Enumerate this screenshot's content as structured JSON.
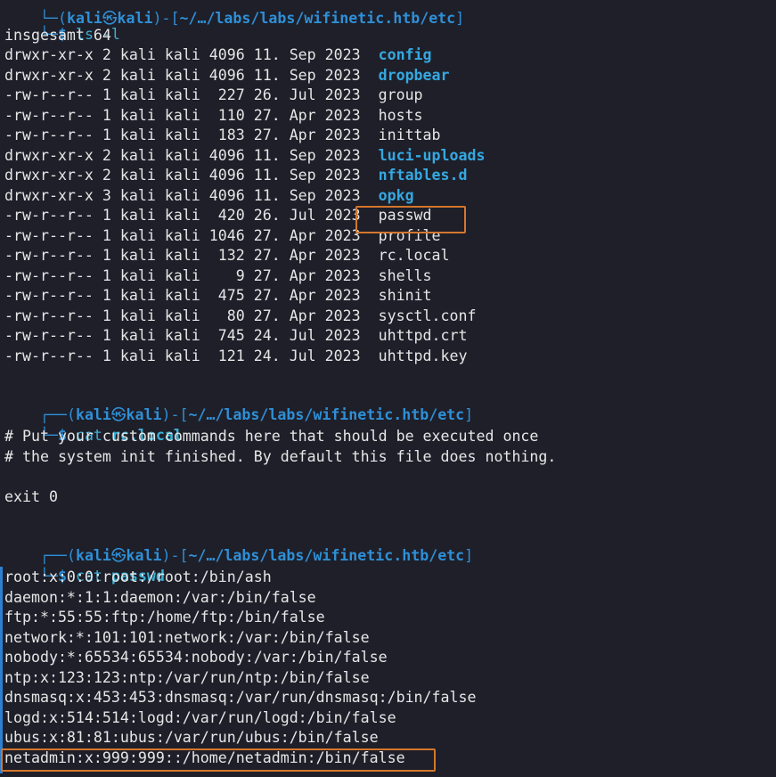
{
  "prompt": {
    "user": "kali",
    "host": "kali",
    "at_symbol": "㉿",
    "path": "~/…/labs/labs/wifinetic.htb/etc",
    "dollar": "$"
  },
  "ls_command": {
    "cmd": "ls",
    "args": "-l"
  },
  "ls_total": "insgesamt 64",
  "ls_entries": [
    {
      "meta": "drwxr-xr-x 2 kali kali 4096 11. Sep 2023  ",
      "name": "config",
      "dir": true
    },
    {
      "meta": "drwxr-xr-x 2 kali kali 4096 11. Sep 2023  ",
      "name": "dropbear",
      "dir": true
    },
    {
      "meta": "-rw-r--r-- 1 kali kali  227 26. Jul 2023  ",
      "name": "group",
      "dir": false
    },
    {
      "meta": "-rw-r--r-- 1 kali kali  110 27. Apr 2023  ",
      "name": "hosts",
      "dir": false
    },
    {
      "meta": "-rw-r--r-- 1 kali kali  183 27. Apr 2023  ",
      "name": "inittab",
      "dir": false
    },
    {
      "meta": "drwxr-xr-x 2 kali kali 4096 11. Sep 2023  ",
      "name": "luci-uploads",
      "dir": true
    },
    {
      "meta": "drwxr-xr-x 2 kali kali 4096 11. Sep 2023  ",
      "name": "nftables.d",
      "dir": true
    },
    {
      "meta": "drwxr-xr-x 3 kali kali 4096 11. Sep 2023  ",
      "name": "opkg",
      "dir": true
    },
    {
      "meta": "-rw-r--r-- 1 kali kali  420 26. Jul 2023  ",
      "name": "passwd",
      "dir": false
    },
    {
      "meta": "-rw-r--r-- 1 kali kali 1046 27. Apr 2023  ",
      "name": "profile",
      "dir": false
    },
    {
      "meta": "-rw-r--r-- 1 kali kali  132 27. Apr 2023  ",
      "name": "rc.local",
      "dir": false
    },
    {
      "meta": "-rw-r--r-- 1 kali kali    9 27. Apr 2023  ",
      "name": "shells",
      "dir": false
    },
    {
      "meta": "-rw-r--r-- 1 kali kali  475 27. Apr 2023  ",
      "name": "shinit",
      "dir": false
    },
    {
      "meta": "-rw-r--r-- 1 kali kali   80 27. Apr 2023  ",
      "name": "sysctl.conf",
      "dir": false
    },
    {
      "meta": "-rw-r--r-- 1 kali kali  745 24. Jul 2023  ",
      "name": "uhttpd.crt",
      "dir": false
    },
    {
      "meta": "-rw-r--r-- 1 kali kali  121 24. Jul 2023  ",
      "name": "uhttpd.key",
      "dir": false
    }
  ],
  "cat1": {
    "cmd": "cat",
    "arg": "rc.local"
  },
  "rc_local_lines": [
    "# Put your custom commands here that should be executed once",
    "# the system init finished. By default this file does nothing.",
    "",
    "exit 0"
  ],
  "cat2": {
    "cmd": "cat",
    "arg": "passwd"
  },
  "passwd_lines": [
    "root:x:0:0:root:/root:/bin/ash",
    "daemon:*:1:1:daemon:/var:/bin/false",
    "ftp:*:55:55:ftp:/home/ftp:/bin/false",
    "network:*:101:101:network:/var:/bin/false",
    "nobody:*:65534:65534:nobody:/var:/bin/false",
    "ntp:x:123:123:ntp:/var/run/ntp:/bin/false",
    "dnsmasq:x:453:453:dnsmasq:/var/run/dnsmasq:/bin/false",
    "logd:x:514:514:logd:/var/run/logd:/bin/false",
    "ubus:x:81:81:ubus:/var/run/ubus:/bin/false",
    "netadmin:x:999:999::/home/netadmin:/bin/false"
  ],
  "colors": {
    "background": "#1e1f29",
    "prompt_blue": "#2f8fd6",
    "directory_blue": "#35a8e0",
    "highlight_orange": "#d4762c",
    "text": "#e6e6e6"
  }
}
